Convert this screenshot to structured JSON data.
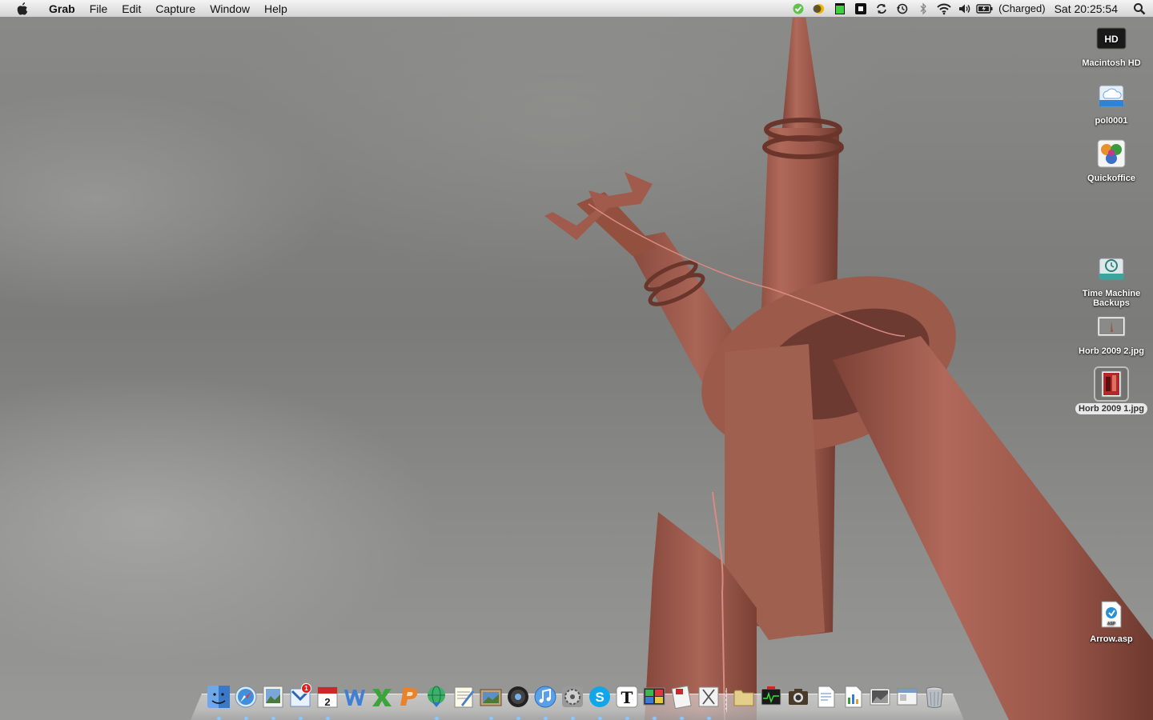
{
  "menubar": {
    "app_name": "Grab",
    "menus": [
      "File",
      "Edit",
      "Capture",
      "Window",
      "Help"
    ],
    "battery_status": "(Charged)",
    "clock": "Sat 20:25:54"
  },
  "desktop_icons": {
    "macintosh_hd": "Macintosh HD",
    "pol0001": "pol0001",
    "quickoffice": "Quickoffice",
    "time_machine": "Time Machine Backups",
    "horb2": "Horb 2009 2.jpg",
    "horb1": "Horb 2009 1.jpg",
    "arrow": "Arrow.asp"
  },
  "dock": {
    "calendar_day": "2",
    "mail_badge": "1"
  },
  "colors": {
    "sculpture": "#9a5a4e",
    "sky": "#7d7d7b",
    "selection_label": "#e8e8e8"
  }
}
